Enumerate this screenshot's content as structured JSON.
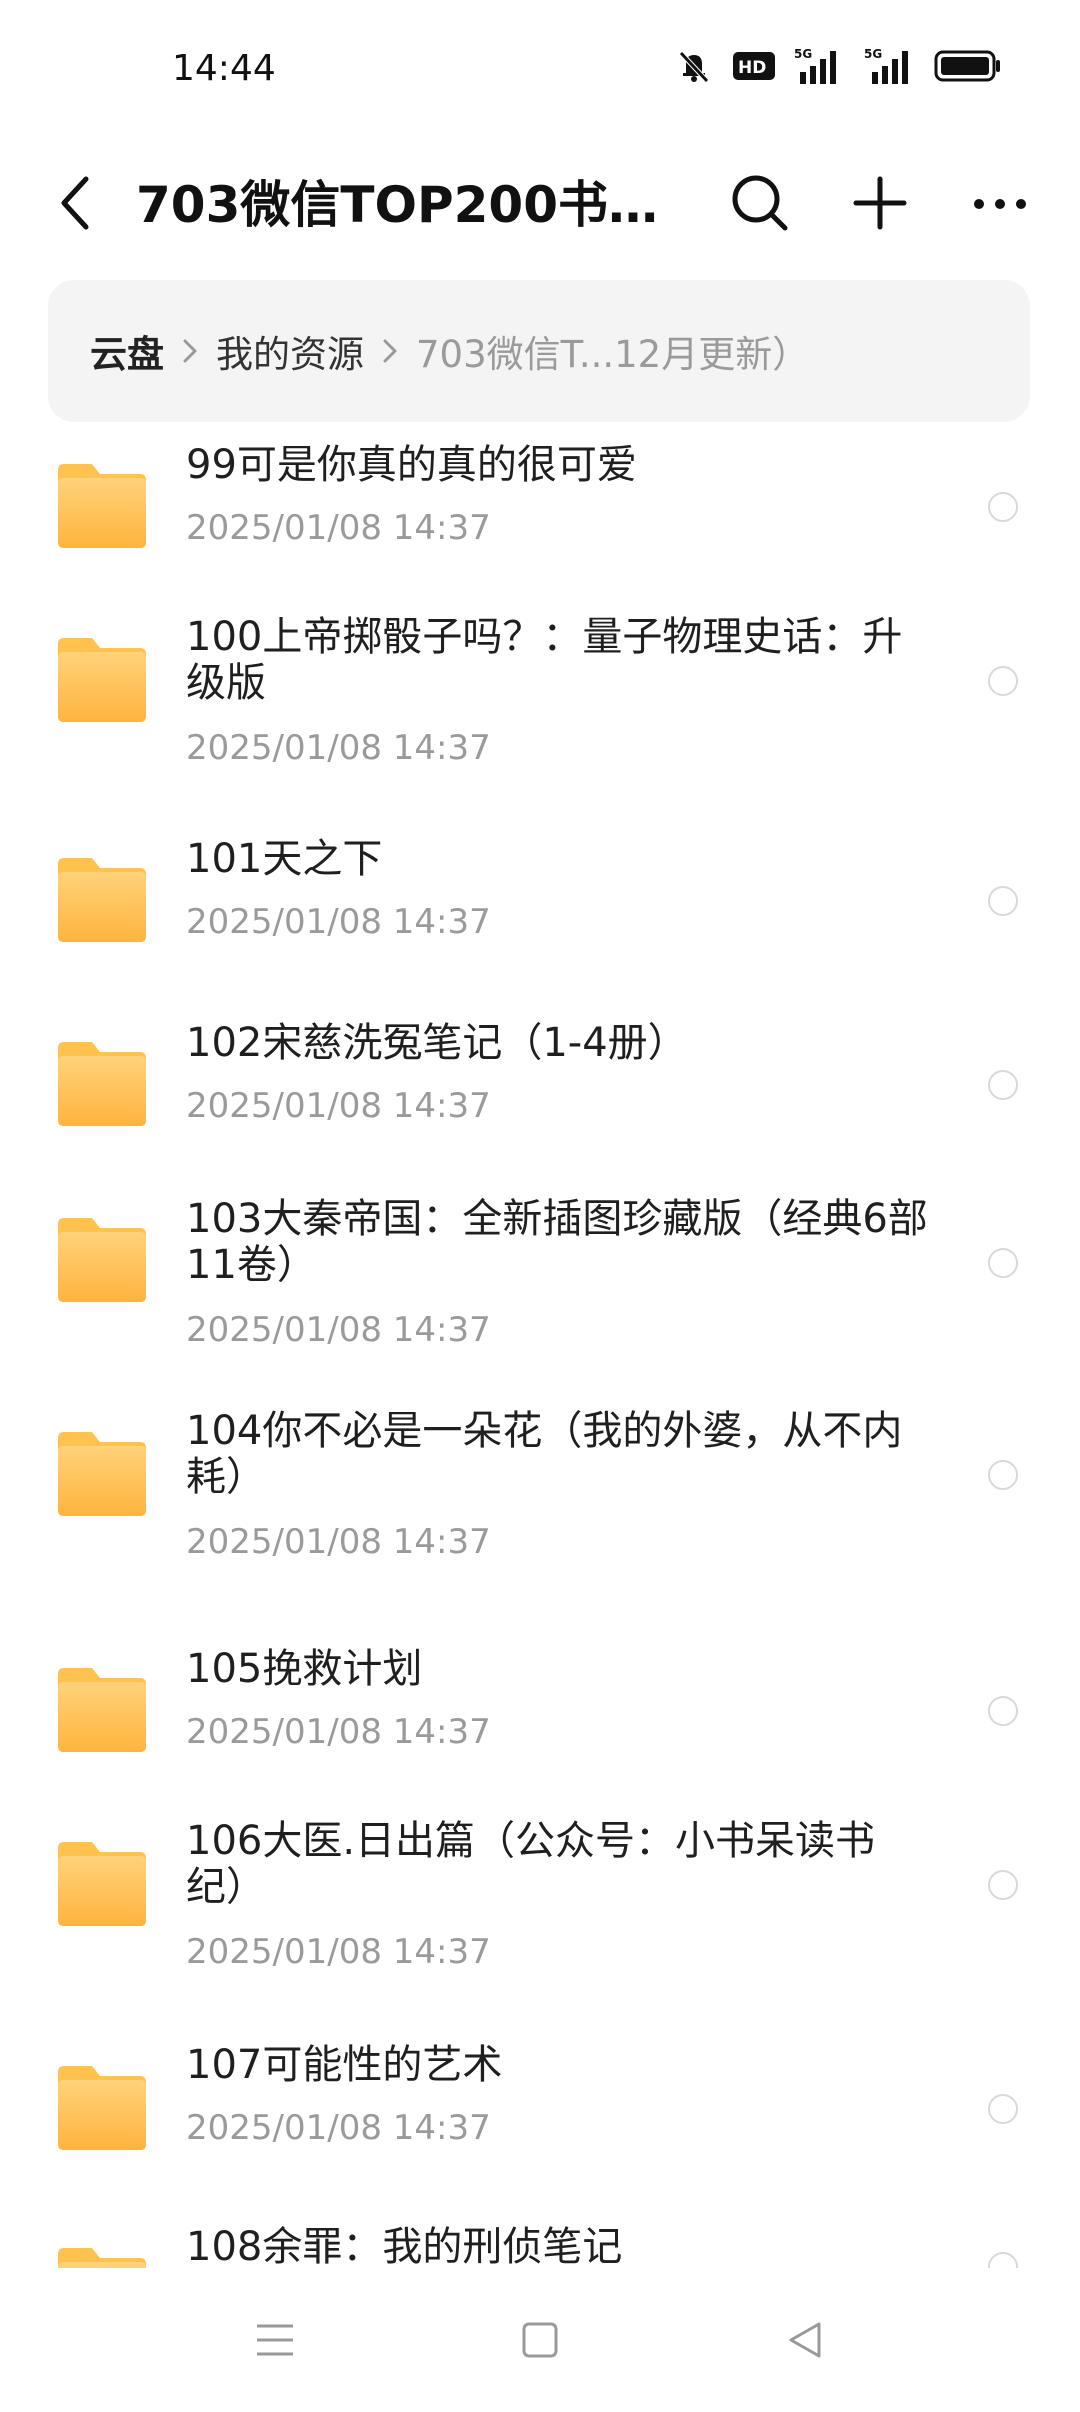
{
  "status_bar": {
    "time": "14:44",
    "icons": [
      "mute-icon",
      "hd-icon",
      "signal-5g-icon",
      "signal-5g-icon",
      "battery-icon"
    ],
    "hd_label": "HD",
    "net1": "5G",
    "net2": "5G"
  },
  "header": {
    "title": "703微信TOP200书…",
    "back_icon": "chevron-left-icon",
    "search_icon": "search-icon",
    "add_icon": "plus-icon",
    "more_icon": "more-horizontal-icon"
  },
  "breadcrumb": {
    "root": "云盘",
    "mid": "我的资源",
    "current": "703微信T...12月更新）"
  },
  "files": [
    {
      "name": "99可是你真的真的很可爱",
      "date": "2025/01/08 14:37"
    },
    {
      "name": "100上帝掷骰子吗？：量子物理史话：升级版",
      "date": "2025/01/08 14:37"
    },
    {
      "name": "101天之下",
      "date": "2025/01/08 14:37"
    },
    {
      "name": "102宋慈洗冤笔记（1-4册）",
      "date": "2025/01/08 14:37"
    },
    {
      "name": "103大秦帝国：全新插图珍藏版（经典6部11卷）",
      "date": "2025/01/08 14:37"
    },
    {
      "name": "104你不必是一朵花（我的外婆，从不内耗）",
      "date": "2025/01/08 14:37"
    },
    {
      "name": "105挽救计划",
      "date": "2025/01/08 14:37"
    },
    {
      "name": "106大医.日出篇（公众号：小书呆读书纪）",
      "date": "2025/01/08 14:37"
    },
    {
      "name": "107可能性的艺术",
      "date": "2025/01/08 14:37"
    },
    {
      "name": "108余罪：我的刑侦笔记",
      "date": ""
    }
  ],
  "nav_bar": {
    "menu_icon": "menu-icon",
    "home_icon": "home-square-icon",
    "back_icon": "back-triangle-icon"
  },
  "colors": {
    "folder_top": "#ffd27a",
    "folder_bottom": "#ffb43d",
    "breadcrumb_bg": "#f4f4f5",
    "secondary_text": "#9a9a9a"
  }
}
